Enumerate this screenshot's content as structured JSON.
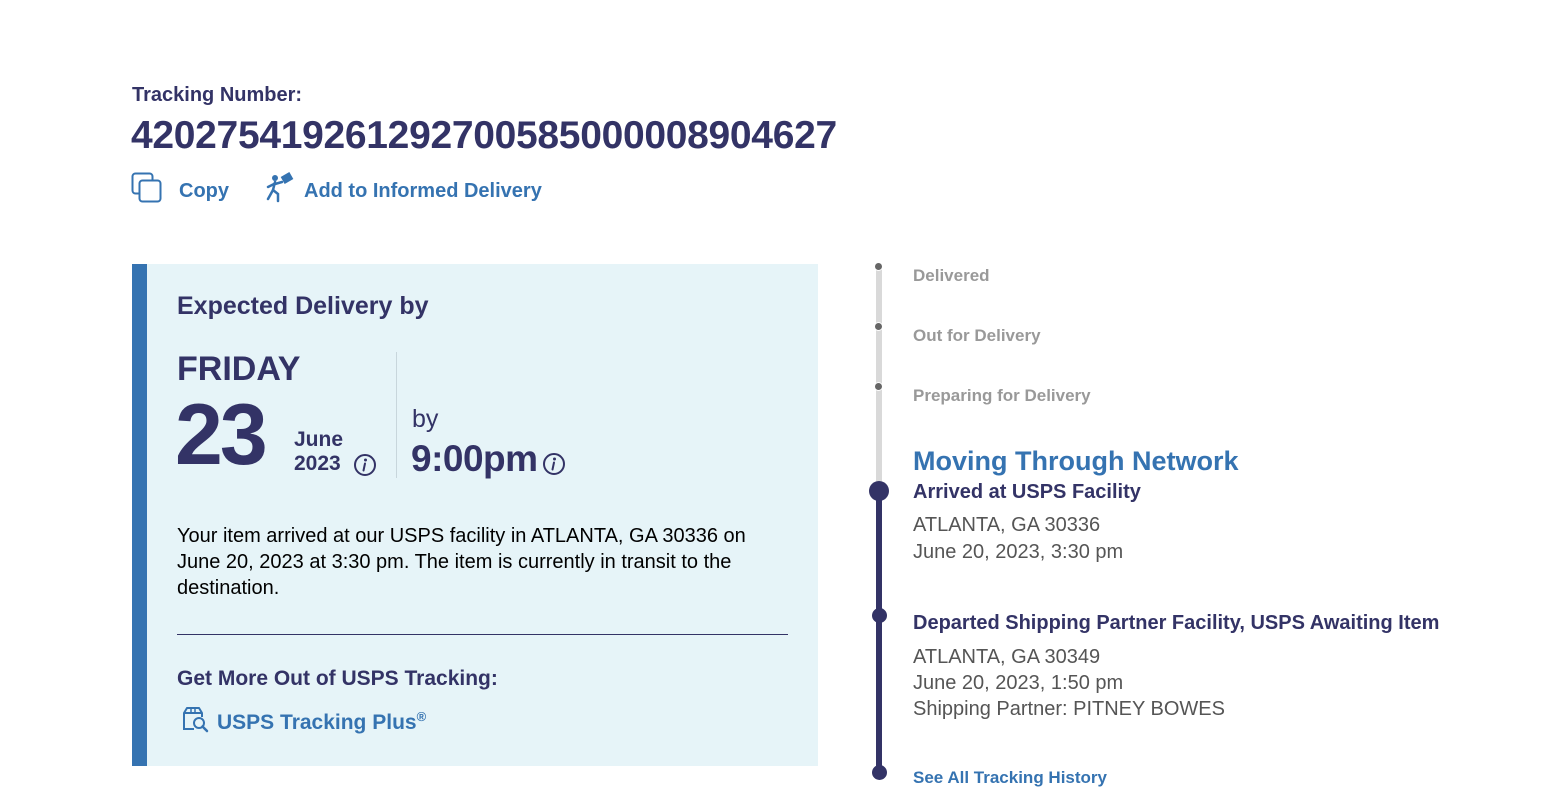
{
  "header": {
    "tracking_label": "Tracking Number:",
    "tracking_number": "420275419261292700585000008904627",
    "copy_label": "Copy",
    "informed_delivery_label": "Add to Informed Delivery"
  },
  "expected": {
    "title": "Expected Delivery by",
    "day_name": "FRIDAY",
    "day_number": "23",
    "month": "June",
    "year": "2023",
    "by_label": "by",
    "time": "9:00pm",
    "description": "Your item arrived at our USPS facility in ATLANTA, GA 30336 on June 20, 2023 at 3:30 pm. The item is currently in transit to the destination.",
    "more_title": "Get More Out of USPS Tracking:",
    "plus_label": "USPS Tracking Plus",
    "plus_mark": "®"
  },
  "timeline": {
    "future_steps": [
      "Delivered",
      "Out for Delivery",
      "Preparing for Delivery"
    ],
    "current_status": "Moving Through Network",
    "events": [
      {
        "title": "Arrived at USPS Facility",
        "location": "ATLANTA, GA 30336",
        "datetime": "June 20, 2023, 3:30 pm"
      },
      {
        "title": "Departed Shipping Partner Facility, USPS Awaiting Item",
        "location": "ATLANTA, GA 30349",
        "datetime": "June 20, 2023, 1:50 pm",
        "extra": "Shipping Partner: PITNEY BOWES"
      }
    ],
    "see_all_label": "See All Tracking History"
  },
  "colors": {
    "navy": "#333366",
    "link_blue": "#3573b1",
    "panel_bg": "#e6f4f8",
    "step_gray": "#999999"
  },
  "icons": {
    "copy": "copy-icon",
    "informed_delivery": "mail-carrier-icon",
    "info": "info-icon",
    "tracking_plus": "package-search-icon"
  }
}
